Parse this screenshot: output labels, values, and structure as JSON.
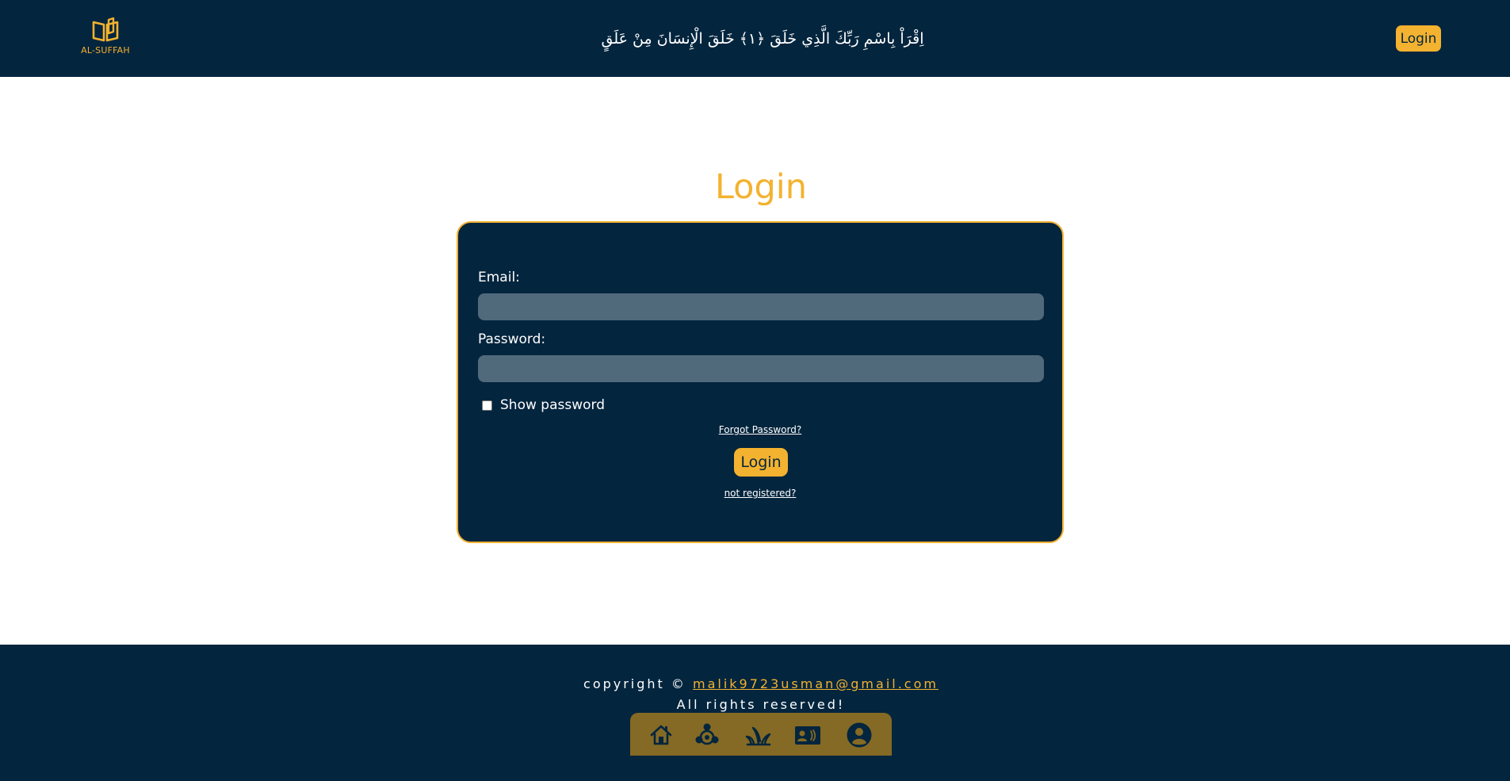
{
  "header": {
    "logo_text": "AL-SUFFAH",
    "ayah": "اِقْرَاْ بِاسْمِ رَبِّكَ الَّذِي خَلَقَ ﴿١﴾ خَلَقَ الْإِنسَانَ مِنْ عَلَقٍ",
    "login_label": "Login"
  },
  "main": {
    "title": "Login"
  },
  "form": {
    "email_label": "Email:",
    "email_value": "",
    "password_label": "Password:",
    "password_value": "",
    "show_password_label": "Show password",
    "show_password_checked": false,
    "forgot_link": "Forgot Password?",
    "login_label": "Login",
    "not_registered_link": "not registered?"
  },
  "footer": {
    "copyright_prefix": "copyright © ",
    "email": "malik9723usman@gmail.com",
    "rights": "All rights reserved!",
    "nav_icons": [
      "home-icon",
      "community-icon",
      "grass-icon",
      "contact-card-icon",
      "account-icon"
    ]
  },
  "colors": {
    "navy": "#04253e",
    "gold": "#f3b22f",
    "input_bg": "#506a7b",
    "iconbar_bg": "#846a24",
    "icon_color": "#04253e"
  }
}
